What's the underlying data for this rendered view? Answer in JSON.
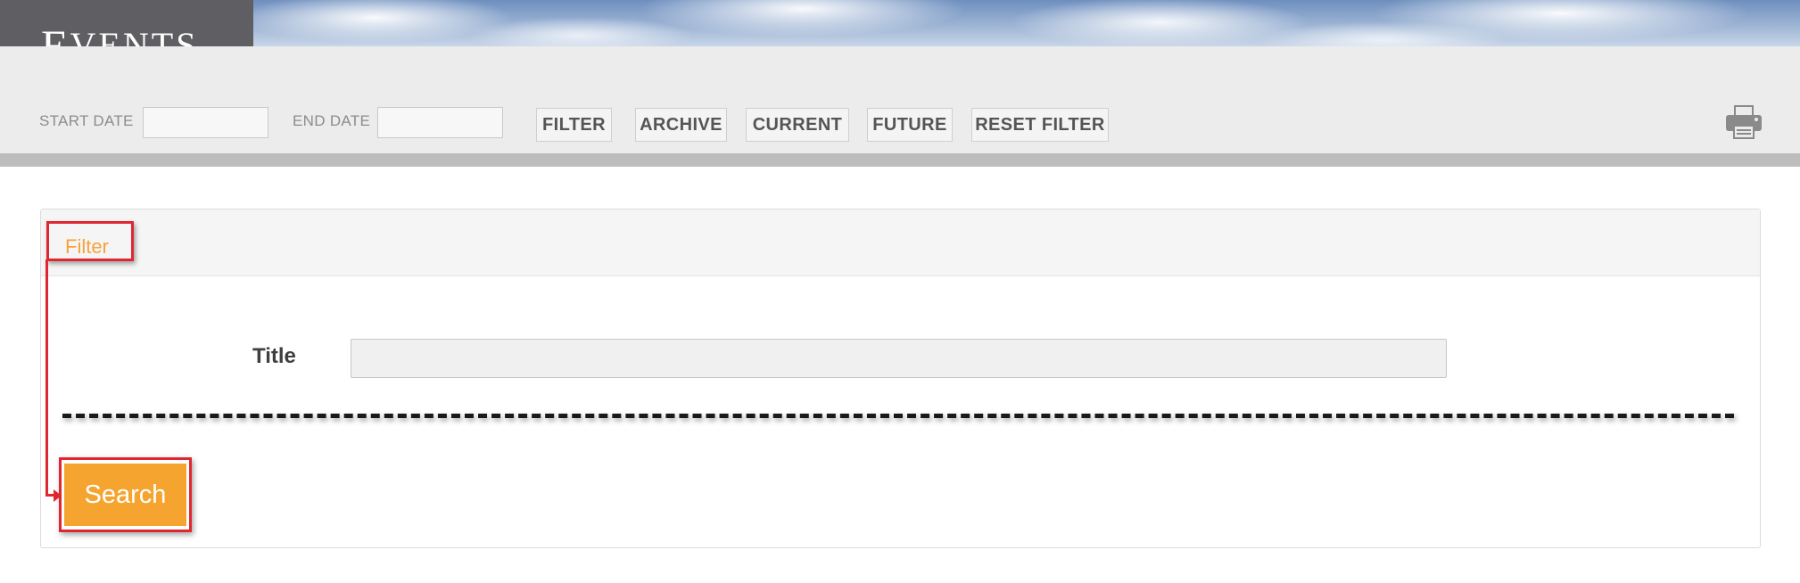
{
  "header": {
    "title_first_letter": "E",
    "title_rest": "VENTS"
  },
  "toolbar": {
    "start_date_label": "START DATE",
    "start_date_value": "",
    "end_date_label": "END DATE",
    "end_date_value": "",
    "buttons": [
      "FILTER",
      "ARCHIVE",
      "CURRENT",
      "FUTURE",
      "RESET FILTER"
    ],
    "print_icon": "printer-icon"
  },
  "filter_panel": {
    "header_link": "Filter",
    "title_label": "Title",
    "title_value": "",
    "search_button": "Search"
  },
  "annotations": {
    "highlight_color": "#e0262f",
    "dashed_separator_color": "#1a1a1a"
  },
  "colors": {
    "accent": "#f5a52f",
    "title_tab": "#5f5f63",
    "toolbar_bg": "#ececec"
  }
}
